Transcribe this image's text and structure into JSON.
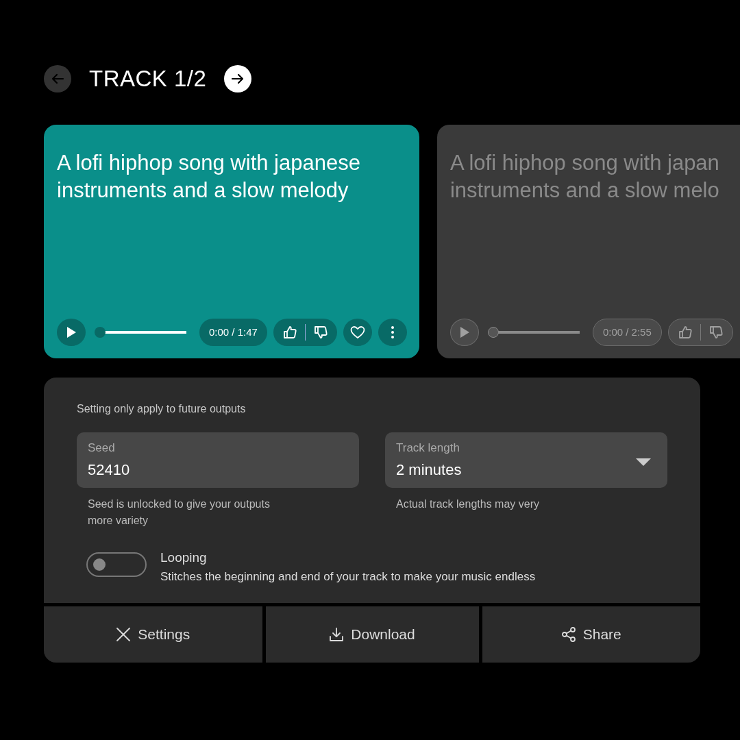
{
  "header": {
    "title": "TRACK 1/2",
    "prev_disabled": true,
    "next_disabled": false
  },
  "tracks": [
    {
      "title_lines": [
        "A lofi hiphop song with japanese",
        "instruments and a slow melody"
      ],
      "active": true,
      "level": 0,
      "time": "0:00 / 1:47",
      "show_more": true
    },
    {
      "title_lines": [
        "A lofi hiphop song with japan",
        "instruments and a slow melo"
      ],
      "active": false,
      "level": 0,
      "time": "0:00 / 2:55",
      "show_more": false
    }
  ],
  "settings": {
    "note": "Setting only apply to future outputs",
    "fields": [
      {
        "kind": "text",
        "label": "Seed",
        "value": "52410",
        "helper_lines": [
          "Seed is unlocked to give your outputs",
          "more variety"
        ]
      },
      {
        "kind": "select",
        "label": "Track length",
        "value": "2 minutes",
        "helper_lines": [
          "Actual track lengths may very"
        ]
      }
    ],
    "looping": {
      "label": "Looping",
      "description": "Stitches the beginning and end of your track to make your music endless",
      "on": false
    }
  },
  "actions": [
    {
      "kind": "close",
      "label": "Settings"
    },
    {
      "kind": "download",
      "label": "Download"
    },
    {
      "kind": "share",
      "label": "Share"
    }
  ]
}
